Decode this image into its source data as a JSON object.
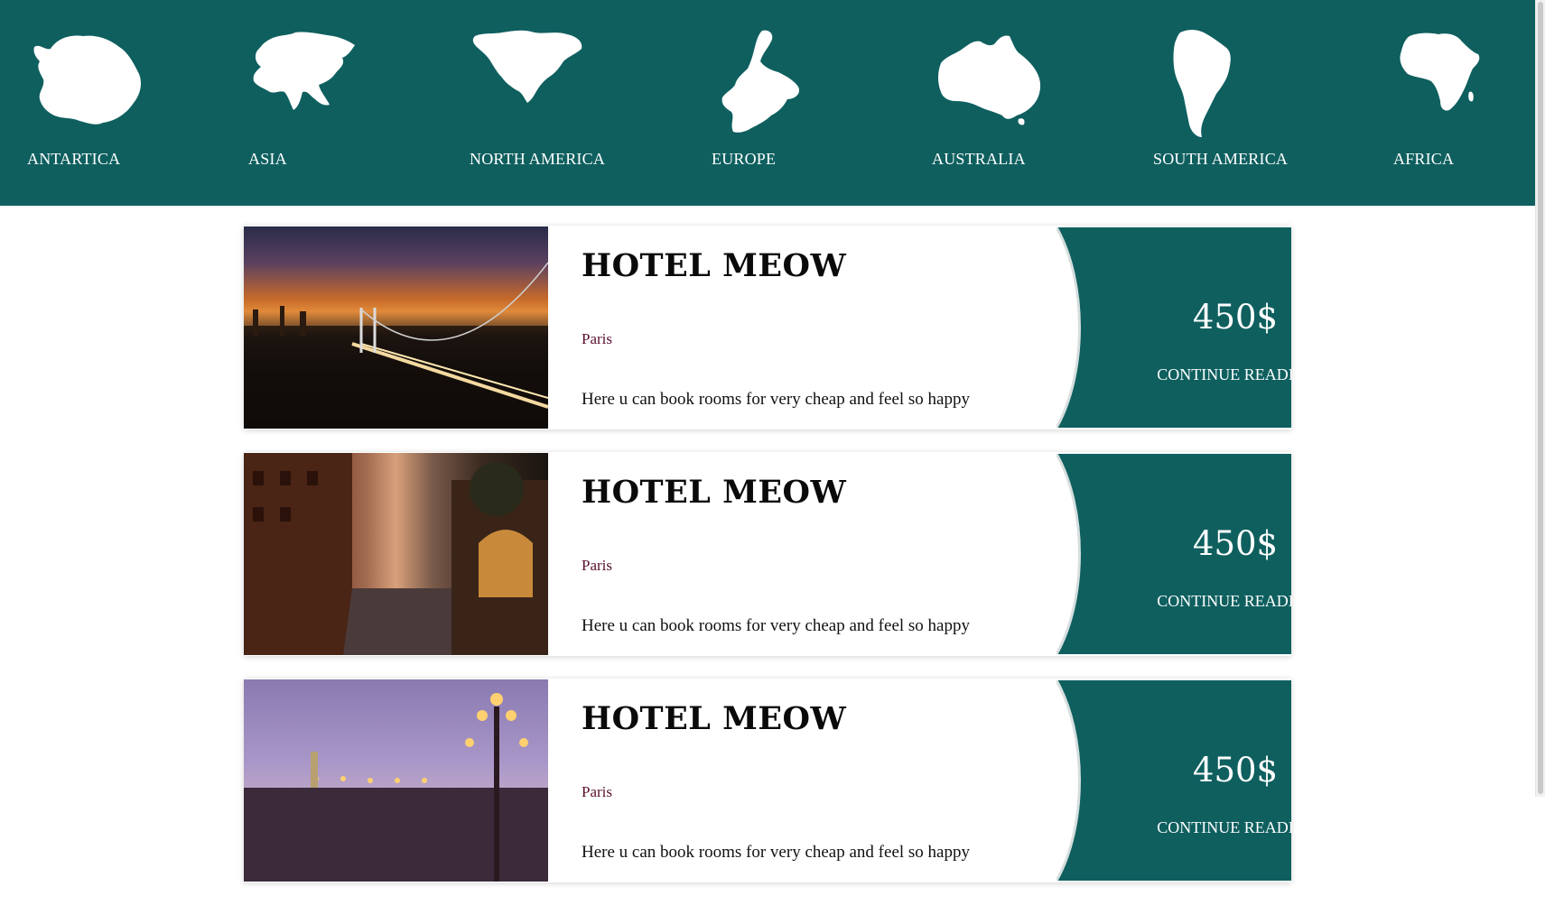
{
  "colors": {
    "brand_teal": "#0f5f5f",
    "city_text": "#5a1030",
    "title_text": "#0a0a0a"
  },
  "continents": [
    {
      "label": "ANTARTICA",
      "icon": "antarctica-map-icon"
    },
    {
      "label": "ASIA",
      "icon": "asia-map-icon"
    },
    {
      "label": "NORTH AMERICA",
      "icon": "north-america-map-icon"
    },
    {
      "label": "EUROPE",
      "icon": "europe-map-icon"
    },
    {
      "label": "AUSTRALIA",
      "icon": "australia-map-icon"
    },
    {
      "label": "SOUTH AMERICA",
      "icon": "south-america-map-icon"
    },
    {
      "label": "AFRICA",
      "icon": "africa-map-icon"
    }
  ],
  "hotels": [
    {
      "title": "HOTEL MEOW",
      "city": "Paris",
      "description": "Here u can book rooms for very cheap and feel so happy",
      "price": "450$",
      "cta": "CONTINUE READING",
      "photo": "bridge-at-sunset-photo"
    },
    {
      "title": "HOTEL MEOW",
      "city": "Paris",
      "description": "Here u can book rooms for very cheap and feel so happy",
      "price": "450$",
      "cta": "CONTINUE READING",
      "photo": "canal-at-dusk-photo"
    },
    {
      "title": "HOTEL MEOW",
      "city": "Paris",
      "description": "Here u can book rooms for very cheap and feel so happy",
      "price": "450$",
      "cta": "CONTINUE READING",
      "photo": "paris-bridge-lamps-photo"
    }
  ]
}
